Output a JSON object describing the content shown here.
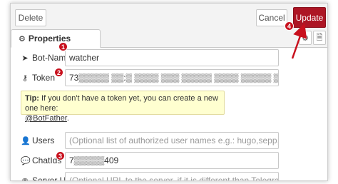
{
  "toolbar": {
    "delete_label": "Delete",
    "cancel_label": "Cancel",
    "update_label": "Update"
  },
  "tabs": {
    "properties_label": "Properties",
    "properties_icon": "gear-icon",
    "side_settings_icon": "gear-icon",
    "side_doc_icon": "document-icon"
  },
  "form": {
    "botname": {
      "label": "Bot-Name",
      "icon": "telegram-icon",
      "value": "watcher",
      "marker": "1"
    },
    "token": {
      "label": "Token",
      "icon": "key-icon",
      "value": "73▒▒▒▒▒ ▒▒:▒ ▒▒▒▒ ▒▒▒ ▒▒▒▒▒ ▒▒▒▒ ▒▒▒▒▒ ▒▒▒U0",
      "marker": "2"
    },
    "tip": {
      "bold": "Tip:",
      "text": " If you don't have a token yet, you can create a new one here:",
      "link": "@BotFather",
      "end": "."
    },
    "users": {
      "label": "Users",
      "icon": "user-icon",
      "placeholder": "(Optional list of authorized user names e.g.: hugo,sepp,egon)"
    },
    "chatids": {
      "label": "ChatIds",
      "icon": "comment-icon",
      "value": "7▒▒▒▒▒409",
      "marker": "3"
    },
    "sendurl": {
      "label": "Server URL",
      "placeholder": "(Optional URL to the server, if it is different than Telegram API server)"
    }
  },
  "annotations": {
    "update_marker": "4",
    "marker_color": "#c8101d",
    "update_color": "#ad1625"
  }
}
